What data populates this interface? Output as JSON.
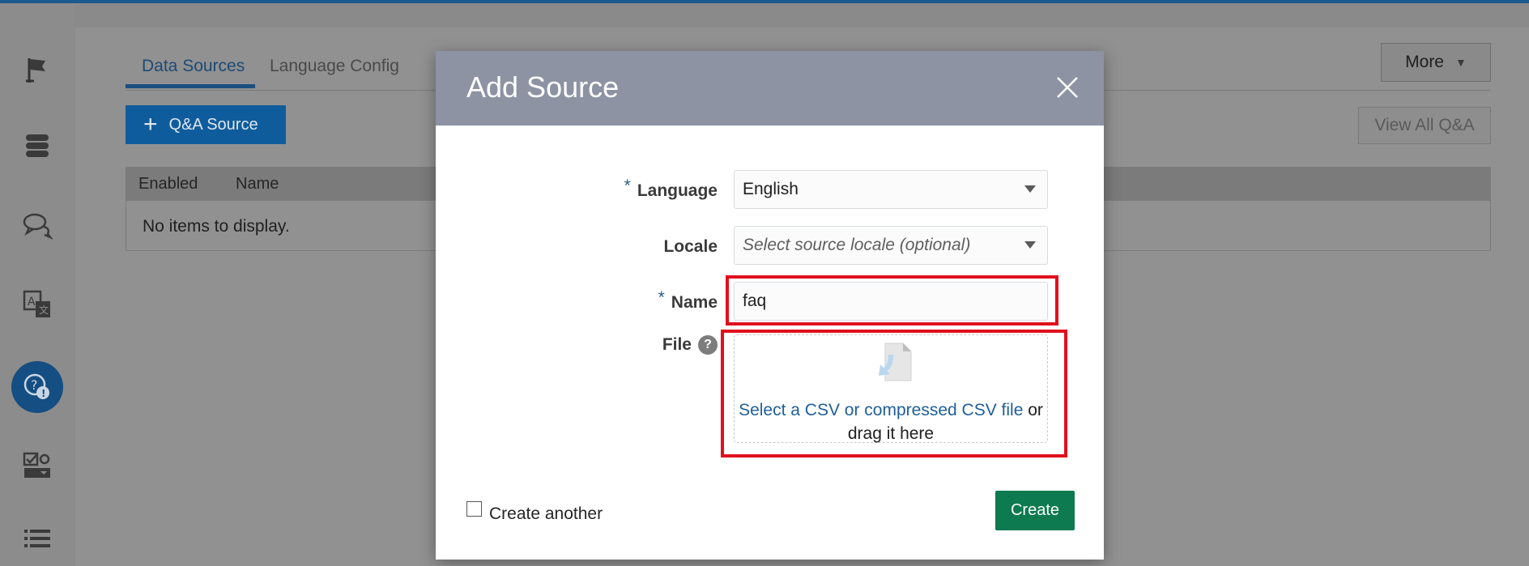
{
  "tabs": {
    "data_sources": "Data Sources",
    "language_config": "Language Config"
  },
  "toolbar": {
    "add_qa_source": "Q&A Source",
    "more": "More",
    "view_all": "View All Q&A"
  },
  "table": {
    "columns": [
      "Enabled",
      "Name"
    ],
    "empty_message": "No items to display."
  },
  "rail": {
    "icons": [
      "flag-icon",
      "database-icon",
      "chat-icon",
      "translate-icon",
      "qna-icon",
      "checklist-icon",
      "list-icon"
    ]
  },
  "dialog": {
    "title": "Add Source",
    "language_label": "Language",
    "language_value": "English",
    "locale_label": "Locale",
    "locale_placeholder": "Select source locale (optional)",
    "name_label": "Name",
    "name_value": "faq",
    "file_label": "File",
    "file_link": "Select a CSV or compressed CSV file",
    "file_or": " or",
    "file_drag": "drag it here",
    "create_another": "Create another",
    "create_button": "Create",
    "required_mark": "*",
    "help_mark": "?"
  },
  "colors": {
    "accent": "#0f5c9d",
    "create": "#0d7a4f",
    "highlight": "#e0101e",
    "dialog_header": "#8d93a3"
  }
}
